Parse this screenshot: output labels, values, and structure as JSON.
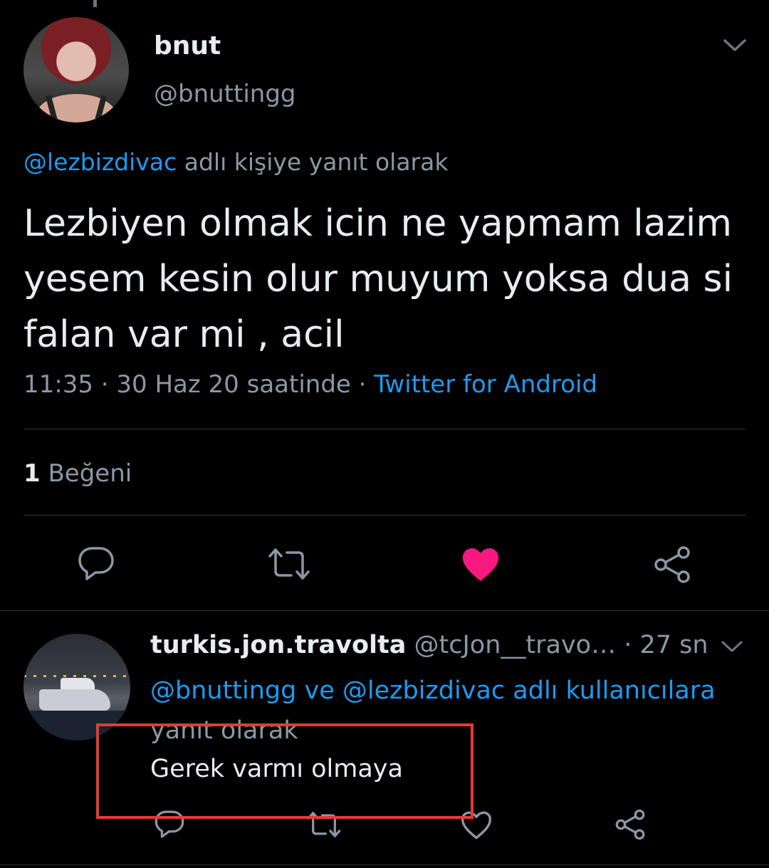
{
  "main_tweet": {
    "author": {
      "name": "bnut",
      "handle": "@bnuttingg"
    },
    "reply_context": {
      "mention": "@lezbizdivac",
      "suffix": " adlı kişiye yanıt olarak"
    },
    "text": "Lezbiyen olmak icin ne yapmam lazim yesem kesin olur muyum yoksa dua si falan var mi , acil",
    "meta": {
      "timestamp": "11:35 · 30 Haz 20 saatinde · ",
      "source": "Twitter for Android"
    },
    "likes": {
      "count": "1",
      "label": " Beğeni"
    },
    "actions": {
      "like_color": "#f91880",
      "liked": true
    }
  },
  "reply_tweet": {
    "author": {
      "name": "turkis.jon.travolta",
      "handle": " @tcJon__travo…",
      "time": " · 27 sn"
    },
    "reply_to": {
      "mentions": "@bnuttingg ve @lezbizdivac adlı kullanıcılara",
      "suffix": "yanıt olarak"
    },
    "text": "Gerek varmı olmaya"
  },
  "theme": {
    "background": "#000000",
    "accent": "#1d9bf0",
    "muted_text": "#8b98a5",
    "highlight_box": "#e53935"
  }
}
